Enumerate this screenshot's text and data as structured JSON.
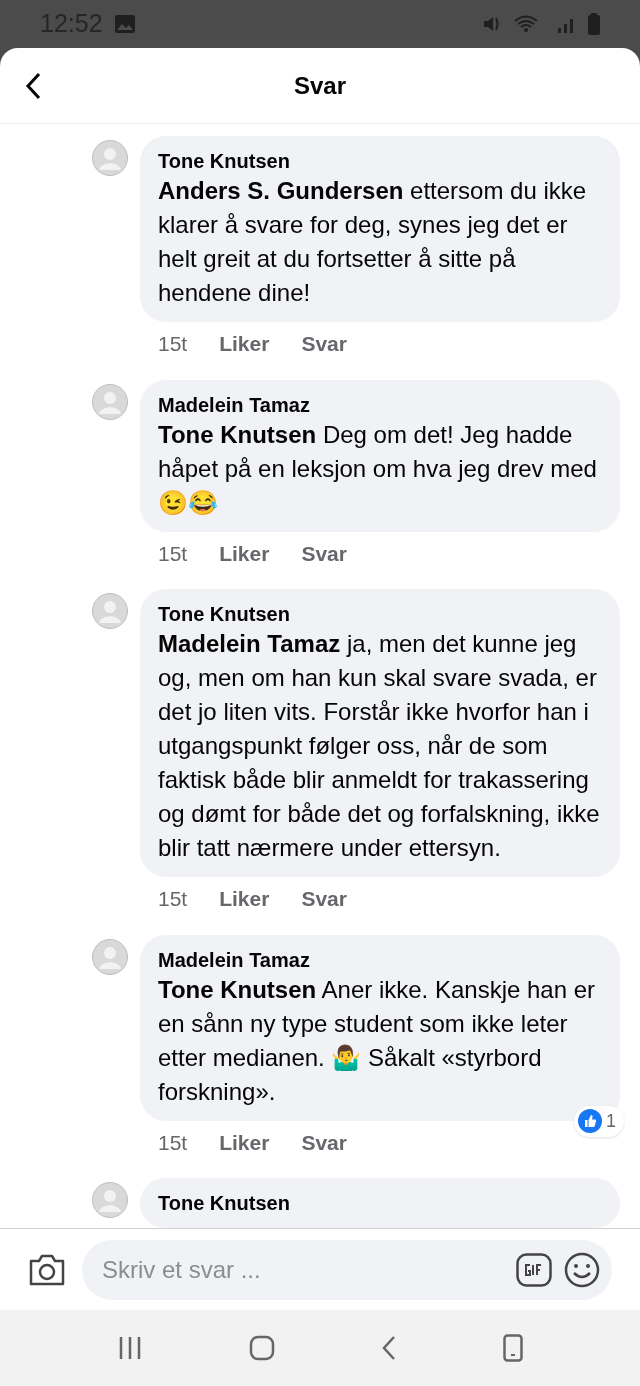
{
  "status_bar": {
    "time": "12:52"
  },
  "header": {
    "title": "Svar"
  },
  "comments": [
    {
      "author": "Tone Knutsen",
      "text": "**Anders S. Gundersen** ettersom du ikke klarer å svare for deg, synes jeg det er helt greit at du fortsetter å sitte på hendene dine!",
      "time": "15t",
      "actions": [
        "Liker",
        "Svar"
      ]
    },
    {
      "author": "Madelein Tamaz",
      "text": "**Tone Knutsen** Deg om det! Jeg hadde håpet på en leksjon om hva jeg drev med 😉😂",
      "time": "15t",
      "actions": [
        "Liker",
        "Svar"
      ]
    },
    {
      "author": "Tone Knutsen",
      "text": "**Madelein Tamaz** ja, men det kunne jeg og, men om han kun skal svare svada, er det jo liten vits. Forstår ikke hvorfor han i utgangspunkt følger oss, når de som faktisk både blir anmeldt for trakassering og dømt for både det og forfalskning, ikke blir tatt nærmere under ettersyn.",
      "time": "15t",
      "actions": [
        "Liker",
        "Svar"
      ]
    },
    {
      "author": "Madelein Tamaz",
      "text": "**Tone Knutsen** Aner ikke. Kanskje han er en sånn ny type student som ikke leter etter medianen. 🤷‍♂️ Såkalt «styrbord forskning».",
      "time": "15t",
      "actions": [
        "Liker",
        "Svar"
      ],
      "reaction_count": "1"
    },
    {
      "author": "Tone Knutsen"
    }
  ],
  "composer": {
    "placeholder": "Skriv et svar ..."
  }
}
